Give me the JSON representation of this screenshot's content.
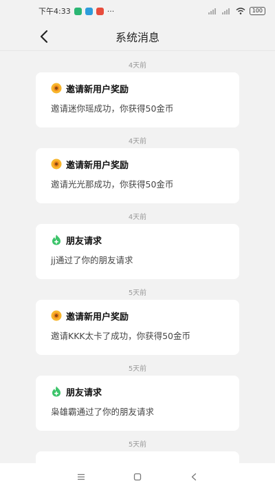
{
  "status_bar": {
    "time": "下午4:33",
    "more": "···",
    "battery": "100"
  },
  "header": {
    "title": "系统消息"
  },
  "messages": [
    {
      "time": "4天前",
      "icon": "sunflower-icon",
      "title": "邀请新用户奖励",
      "body": "邀请迷你瑶成功，你获得50金币"
    },
    {
      "time": "4天前",
      "icon": "sunflower-icon",
      "title": "邀请新用户奖励",
      "body": "邀请光光那成功，你获得50金币"
    },
    {
      "time": "4天前",
      "icon": "flame-icon",
      "title": "朋友请求",
      "body": "jj通过了你的朋友请求"
    },
    {
      "time": "5天前",
      "icon": "sunflower-icon",
      "title": "邀请新用户奖励",
      "body": "邀请KKK太卡了成功，你获得50金币"
    },
    {
      "time": "5天前",
      "icon": "flame-icon",
      "title": "朋友请求",
      "body": "枭雄霸通过了你的朋友请求"
    },
    {
      "time": "5天前",
      "icon": "",
      "title": "",
      "body": ""
    }
  ],
  "colors": {
    "background": "#f2f2f2",
    "card": "#ffffff",
    "sunflower": "#f5a623",
    "flame": "#3cc46a"
  }
}
